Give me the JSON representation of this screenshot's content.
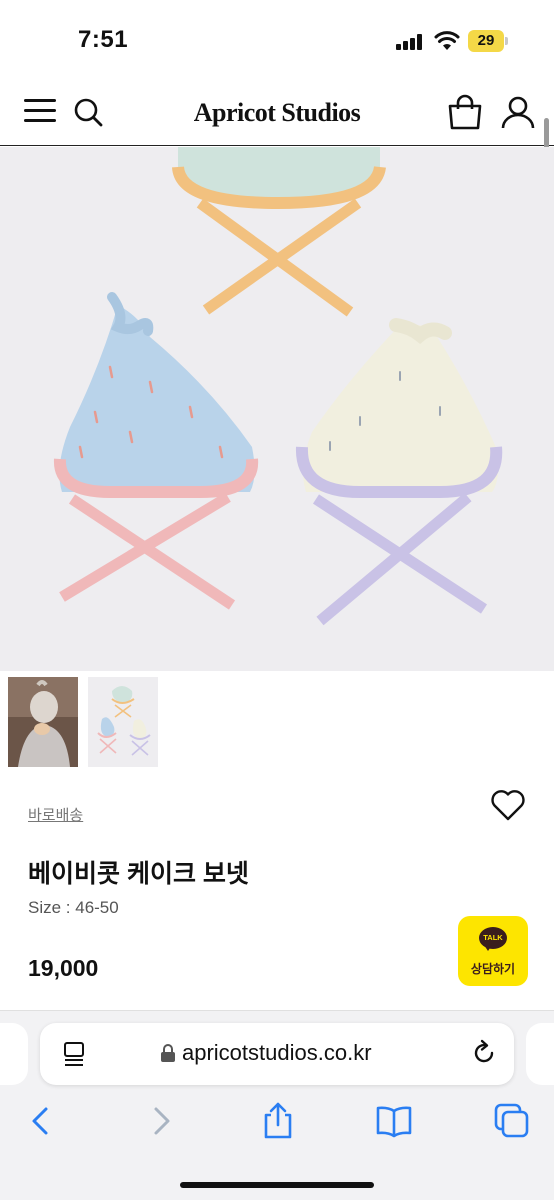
{
  "status_bar": {
    "time": "7:51",
    "battery_level": "29",
    "battery_color": "#f4d847"
  },
  "header": {
    "logo": "Apricot Studios",
    "icons": [
      "menu-icon",
      "search-icon",
      "shopping-bag-icon",
      "user-icon"
    ]
  },
  "product": {
    "shipping_badge": "바로배송",
    "title": "베이비콧 케이크 보넷",
    "size": "Size : 46-50",
    "price": "19,000",
    "images": [
      "product-photo-main",
      "thumbnail-model",
      "thumbnail-bonnets"
    ],
    "bonnet_colors": {
      "sky_blue": "#b9d3ea",
      "pink_trim": "#f0b8b9",
      "cream": "#f1efdf",
      "lavender_trim": "#c9c2e6",
      "mint": "#cfe3dc",
      "orange_trim": "#f2c17f"
    }
  },
  "chat": {
    "bubble": "TALK",
    "label": "상담하기",
    "color": "#fde500"
  },
  "browser": {
    "url": "apricotstudios.co.kr",
    "toolbar": [
      "back-icon",
      "forward-icon",
      "share-icon",
      "bookmarks-icon",
      "tabs-icon"
    ]
  }
}
